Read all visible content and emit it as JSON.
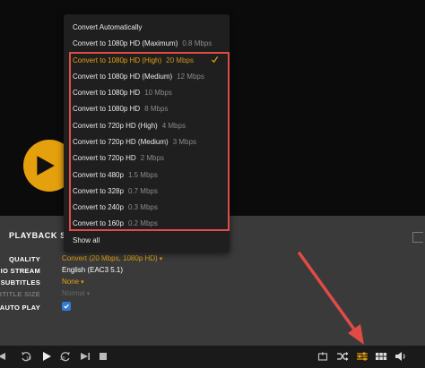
{
  "menu": {
    "items": [
      {
        "label": "Convert Automatically",
        "rate": ""
      },
      {
        "label": "Convert to 1080p HD (Maximum)",
        "rate": "0.8 Mbps"
      },
      {
        "label": "Convert to 1080p HD (High)",
        "rate": "20 Mbps",
        "selected": true
      },
      {
        "label": "Convert to 1080p HD (Medium)",
        "rate": "12 Mbps"
      },
      {
        "label": "Convert to 1080p HD",
        "rate": "10 Mbps"
      },
      {
        "label": "Convert to 1080p HD",
        "rate": "8 Mbps"
      },
      {
        "label": "Convert to 720p HD (High)",
        "rate": "4 Mbps"
      },
      {
        "label": "Convert to 720p HD (Medium)",
        "rate": "3 Mbps"
      },
      {
        "label": "Convert to 720p HD",
        "rate": "2 Mbps"
      },
      {
        "label": "Convert to 480p",
        "rate": "1.5 Mbps"
      },
      {
        "label": "Convert to 328p",
        "rate": "0.7 Mbps"
      },
      {
        "label": "Convert to 240p",
        "rate": "0.3 Mbps"
      },
      {
        "label": "Convert to 160p",
        "rate": "0.2 Mbps"
      },
      {
        "label": "Show all",
        "rate": ""
      }
    ]
  },
  "settings": {
    "title": "PLAYBACK SE",
    "quality_label": "QUALITY",
    "quality_value": "Convert (20 Mbps, 1080p HD)",
    "audio_label": "DIO STREAM",
    "audio_value": "English (EAC3 5.1)",
    "subtitles_label": "SUBTITLES",
    "subtitles_value": "None",
    "subtitle_size_label": "BTITLE SIZE",
    "subtitle_size_value": "Normal",
    "autoplay_label": "AUTO PLAY",
    "autoplay_checked": true
  },
  "colors": {
    "accent": "#e5a00d",
    "highlight": "#e14b46",
    "checkbox": "#2f7bd6"
  },
  "controls": {
    "skip_back_amount": "10",
    "skip_forward_amount": "30"
  }
}
